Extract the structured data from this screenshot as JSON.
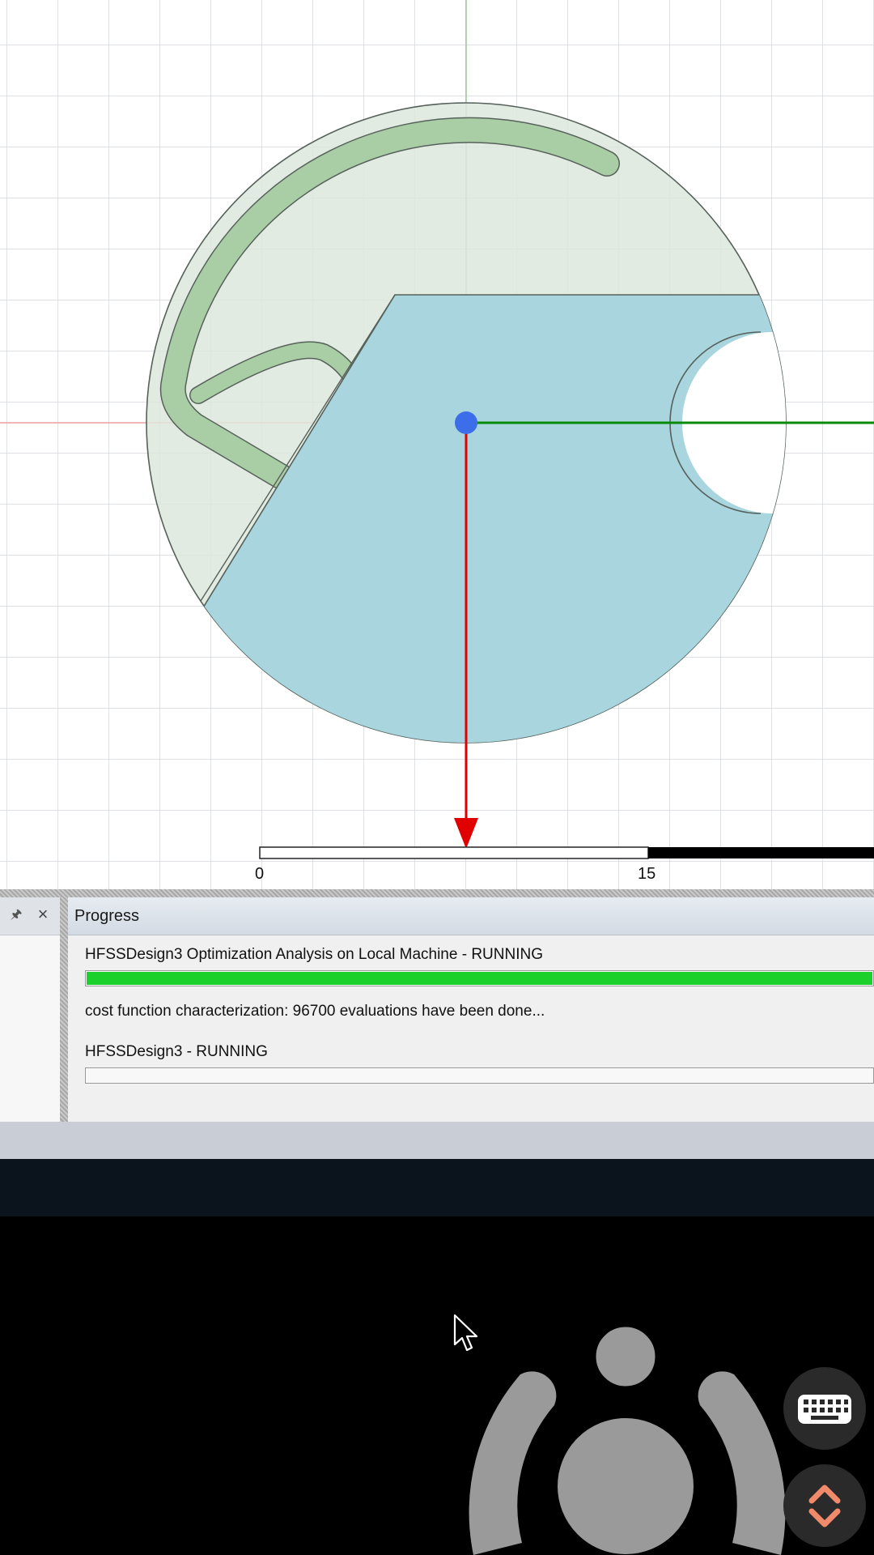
{
  "viewport": {
    "scale_labels": {
      "start": "0",
      "mid": "15"
    }
  },
  "progress": {
    "title": "Progress",
    "items": [
      {
        "text": "HFSSDesign3 Optimization Analysis on Local Machine - RUNNING",
        "progress_fraction": 1.0
      },
      {
        "text": "cost function characterization: 96700 evaluations have been done..."
      },
      {
        "text": "HFSSDesign3 - RUNNING",
        "progress_fraction": 0.0
      }
    ]
  },
  "colors": {
    "progress_fill": "#1bd02a",
    "substrate_fill": "#a8d5de",
    "trace_fill": "#a9cda4",
    "axis_x": "#e00000",
    "axis_y": "#0a8a0a",
    "origin": "#3b6ee8"
  },
  "icons": [
    "pin-icon",
    "close-icon",
    "mouse-cursor-icon",
    "gamepad-icon",
    "keyboard-icon",
    "expand-collapse-icon"
  ]
}
